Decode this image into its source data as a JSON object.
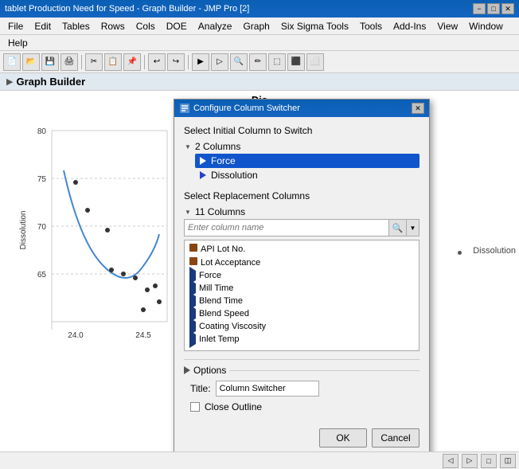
{
  "window": {
    "title": "tablet Production Need for Speed - Graph Builder - JMP Pro [2]",
    "minimize": "−",
    "maximize": "□",
    "close": "✕"
  },
  "menubar": {
    "items": [
      "File",
      "Edit",
      "Tables",
      "Rows",
      "Cols",
      "DOE",
      "Analyze",
      "Graph",
      "Six Sigma Tools",
      "Tools",
      "Add-Ins",
      "View",
      "Window"
    ]
  },
  "helpbar": {
    "items": [
      "Help"
    ]
  },
  "graphBuilder": {
    "title": "Graph Builder",
    "graphSubtitle": "Dis"
  },
  "dialog": {
    "title": "Configure Column Switcher",
    "close": "✕",
    "initialColumnLabel": "Select Initial Column to Switch",
    "twoColumns": "2 Columns",
    "initialItems": [
      {
        "label": "Force",
        "selected": true
      },
      {
        "label": "Dissolution",
        "selected": false
      }
    ],
    "replacementLabel": "Select Replacement Columns",
    "elevenColumns": "11 Columns",
    "searchPlaceholder": "Enter column name",
    "replacementItems": [
      {
        "label": "API Lot No.",
        "iconType": "bar"
      },
      {
        "label": "Lot Acceptance",
        "iconType": "bar"
      },
      {
        "label": "Force",
        "iconType": "triangle"
      },
      {
        "label": "Mill Time",
        "iconType": "triangle"
      },
      {
        "label": "Blend Time",
        "iconType": "triangle"
      },
      {
        "label": "Blend Speed",
        "iconType": "triangle"
      },
      {
        "label": "Coating Viscosity",
        "iconType": "triangle"
      },
      {
        "label": "Inlet Temp",
        "iconType": "triangle"
      }
    ],
    "options": {
      "label": "Options",
      "titleLabel": "Title:",
      "titleValue": "Column Switcher",
      "closeOutline": "Close Outline"
    },
    "okButton": "OK",
    "cancelButton": "Cancel"
  },
  "graph": {
    "yAxisValues": [
      "80",
      "75",
      "70",
      "65"
    ],
    "xAxisValues": [
      "24.0",
      "24.5"
    ],
    "yAxisLabel": "Dissolution",
    "dissolutionRight": "Dissolution"
  },
  "statusBar": {
    "buttons": [
      "◁",
      "▷",
      "□",
      "◫"
    ]
  }
}
